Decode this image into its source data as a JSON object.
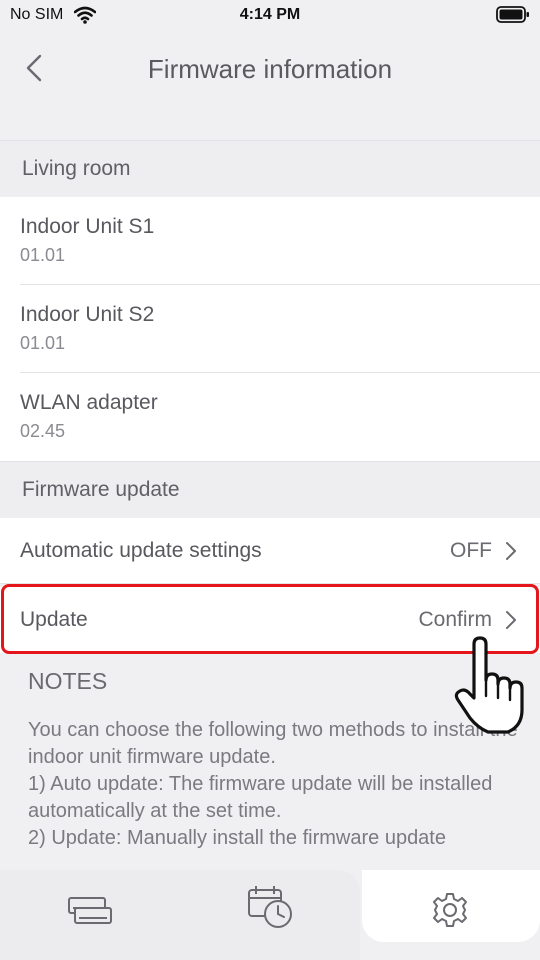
{
  "status_bar": {
    "carrier": "No SIM",
    "time": "4:14 PM"
  },
  "nav": {
    "title": "Firmware information",
    "back_icon": "chevron-left-icon"
  },
  "sections": {
    "living_room": "Living room",
    "firmware_update": "Firmware update"
  },
  "units": [
    {
      "name": "Indoor Unit S1",
      "version": "01.01"
    },
    {
      "name": "Indoor Unit S2",
      "version": "01.01"
    },
    {
      "name": "WLAN adapter",
      "version": "02.45"
    }
  ],
  "settings": {
    "auto_update": {
      "label": "Automatic update settings",
      "value": "OFF"
    },
    "update": {
      "label": "Update",
      "value": "Confirm"
    }
  },
  "notes": {
    "title": "NOTES",
    "lines": [
      "You can choose the following two methods to install the indoor unit firmware update.",
      "1) Auto update: The firmware update will be installed automatically at the set time.",
      "2) Update: Manually install the firmware update"
    ]
  },
  "tabs": [
    {
      "icon": "indoor-units-icon"
    },
    {
      "icon": "timer-icon"
    },
    {
      "icon": "gear-icon"
    }
  ],
  "colors": {
    "highlight": "#e5151c",
    "background": "#f0f0f2"
  }
}
